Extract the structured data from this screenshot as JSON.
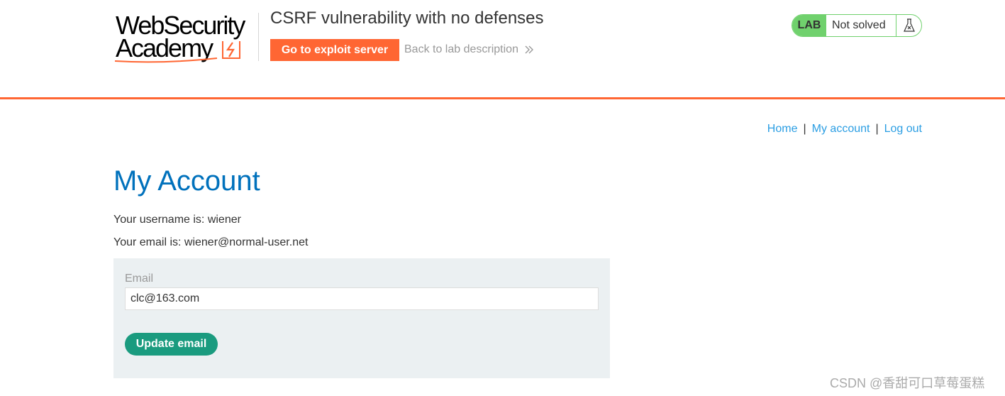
{
  "header": {
    "logo": {
      "line1": "WebSecurity",
      "line2": "Academy"
    },
    "lab_title": "CSRF vulnerability with no defenses",
    "exploit_button": "Go to exploit server",
    "back_link": "Back to lab description",
    "lab_badge": {
      "tag": "LAB",
      "status": "Not solved",
      "icon": "flask-icon"
    }
  },
  "nav": {
    "home": "Home",
    "my_account": "My account",
    "log_out": "Log out",
    "separator": "|"
  },
  "main": {
    "title": "My Account",
    "username_line": "Your username is: wiener",
    "email_line": "Your email is: wiener@normal-user.net",
    "form": {
      "email_label": "Email",
      "email_value": "clc@163.com",
      "submit_label": "Update email"
    }
  },
  "watermark": "CSDN @香甜可口草莓蛋糕",
  "colors": {
    "accent_orange": "#ff6633",
    "lab_green": "#70d16d",
    "link_blue": "#2b9ee3",
    "title_blue": "#0071bc",
    "button_teal": "#1a9b7f",
    "form_bg": "#ebf0f2"
  }
}
